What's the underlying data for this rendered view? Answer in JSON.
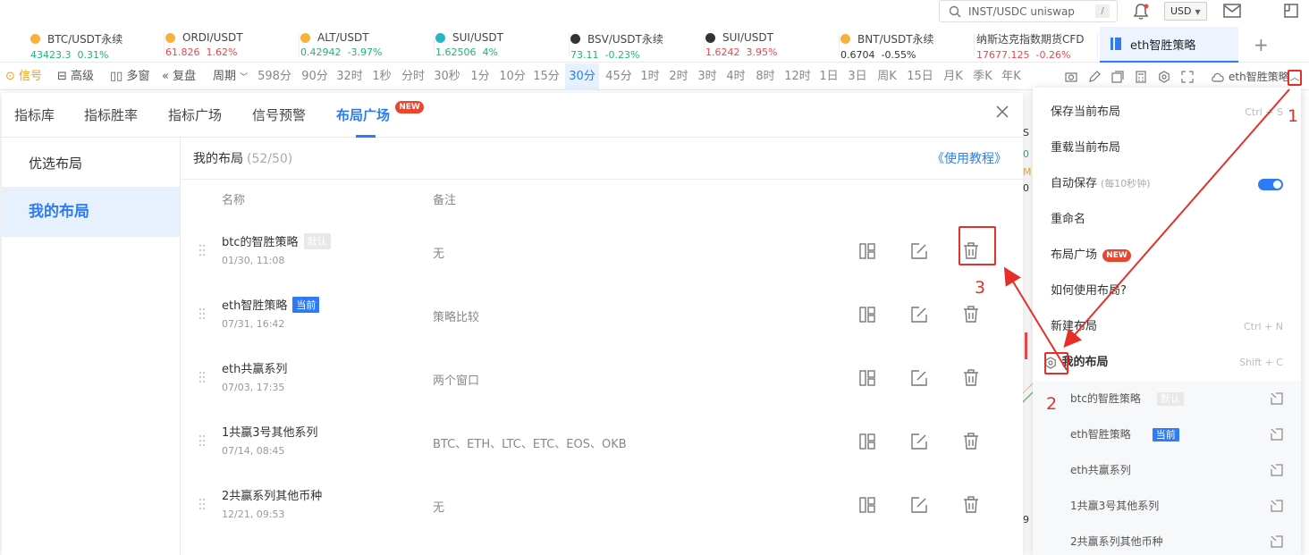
{
  "topbar": {
    "search_value": "INST/USDC uniswap",
    "search_hint": "/",
    "currency": "USD"
  },
  "tickers": [
    {
      "name": "BTC/USDT永续",
      "price": "43423.3",
      "change": "0.31%",
      "trend": "up",
      "coin_color": "#f7b23b"
    },
    {
      "name": "ORDI/USDT",
      "price": "61.826",
      "change": "1.62%",
      "trend": "down",
      "coin_color": "#f7b23b"
    },
    {
      "name": "ALT/USDT",
      "price": "0.42942",
      "change": "-3.97%",
      "trend": "up",
      "coin_color": "#f7b23b"
    },
    {
      "name": "SUI/USDT",
      "price": "1.62506",
      "change": "4%",
      "trend": "up",
      "coin_color": "#22b8c8"
    },
    {
      "name": "BSV/USDT永续",
      "price": "73.11",
      "change": "-0.23%",
      "trend": "up",
      "coin_color": "#333333"
    },
    {
      "name": "SUI/USDT",
      "price": "1.6242",
      "change": "3.95%",
      "trend": "down",
      "coin_color": "#333333"
    },
    {
      "name": "BNT/USDT永续",
      "price": "0.6704",
      "change": "-0.55%",
      "trend": "dark",
      "coin_color": "#f7b23b"
    },
    {
      "name": "纳斯达克指数期货CFD",
      "price": "17677.125",
      "change": "-0.26%",
      "trend": "down",
      "coin_color": ""
    }
  ],
  "active_tab": "eth智胜策略",
  "plus_tab": "+",
  "toolbar": {
    "signal": "信号",
    "advanced": "高级",
    "multi_window": "多窗",
    "replay": "复盘",
    "period": "周期",
    "periods": [
      "598分",
      "90分",
      "32时",
      "1秒",
      "分时",
      "30秒",
      "1分",
      "10分",
      "15分",
      "30分",
      "45分",
      "1时",
      "2时",
      "3时",
      "4时",
      "8时",
      "12时",
      "1日",
      "3日",
      "周K",
      "15日",
      "月K",
      "季K",
      "年K"
    ],
    "selected_period": "30分",
    "layout_name": "eth智胜策略"
  },
  "modal": {
    "tabs": [
      "指标库",
      "指标胜率",
      "指标广场",
      "信号预警",
      "布局广场"
    ],
    "active_tab": "布局广场",
    "new_badge": "NEW",
    "sidebar": [
      "优选布局",
      "我的布局"
    ],
    "sidebar_active": "我的布局",
    "title": "我的布局",
    "count": "(52/50)",
    "tutorial": "《使用教程》",
    "col_name": "名称",
    "col_note": "备注",
    "rows": [
      {
        "name": "btc的智胜策略",
        "tag": "默认",
        "tag_type": "default",
        "date": "01/30, 11:08",
        "note": "无"
      },
      {
        "name": "eth智胜策略",
        "tag": "当前",
        "tag_type": "current",
        "date": "07/31, 16:42",
        "note": "策略比较"
      },
      {
        "name": "eth共赢系列",
        "tag": "",
        "tag_type": "",
        "date": "07/03, 17:35",
        "note": "两个窗口"
      },
      {
        "name": "1共赢3号其他系列",
        "tag": "",
        "tag_type": "",
        "date": "07/14, 08:45",
        "note": "BTC、ETH、LTC、ETC、EOS、OKB"
      },
      {
        "name": "2共赢系列其他币种",
        "tag": "",
        "tag_type": "",
        "date": "12/21, 09:53",
        "note": "无"
      }
    ]
  },
  "menu": {
    "save": "保存当前布局",
    "save_shortcut": "Ctrl + S",
    "reload": "重载当前布局",
    "autosave": "自动保存",
    "autosave_hint": "(每10秒钟)",
    "rename": "重命名",
    "plaza": "布局广场",
    "plaza_badge": "NEW",
    "howto": "如何使用布局?",
    "new_layout": "新建布局",
    "new_shortcut": "Ctrl + N",
    "my_layouts": "我的布局",
    "my_shortcut": "Shift + C",
    "sub_items": [
      {
        "name": "btc的智胜策略",
        "tag": "默认",
        "tag_type": "default"
      },
      {
        "name": "eth智胜策略",
        "tag": "当前",
        "tag_type": "current"
      },
      {
        "name": "eth共赢系列",
        "tag": "",
        "tag_type": ""
      },
      {
        "name": "1共赢3号其他系列",
        "tag": "",
        "tag_type": ""
      },
      {
        "name": "2共赢系列其他币种",
        "tag": "",
        "tag_type": ""
      }
    ]
  },
  "annotations": {
    "one": "1",
    "two": "2",
    "three": "3"
  },
  "colors": {
    "accent": "#2d7cf6",
    "annotation": "#e5302a",
    "up": "#1fb37a",
    "down": "#e5484d"
  }
}
